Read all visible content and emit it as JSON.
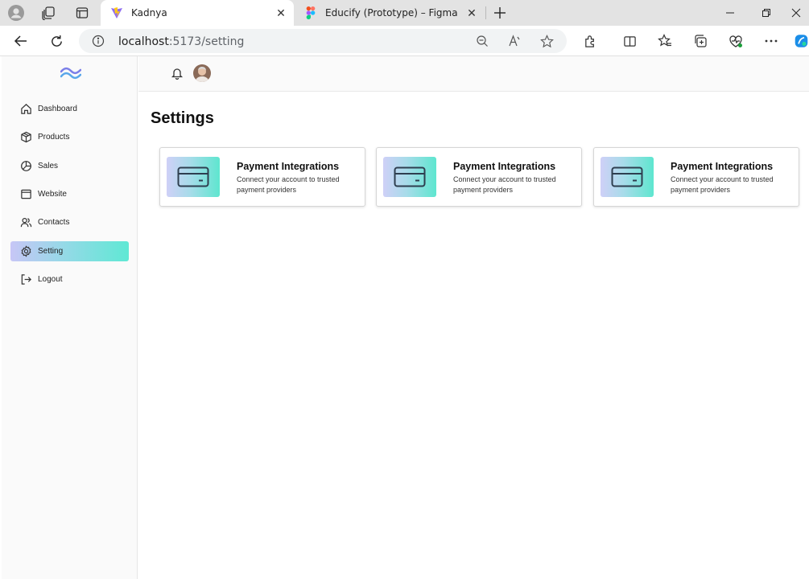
{
  "browser": {
    "tabs": [
      {
        "title": "Kadnya",
        "active": true
      },
      {
        "title": "Educify (Prototype) – Figma",
        "active": false
      }
    ],
    "url": {
      "host": "localhost",
      "path": ":5173/setting"
    }
  },
  "sidebar": {
    "items": [
      {
        "label": "Dashboard",
        "icon": "home-icon",
        "active": false
      },
      {
        "label": "Products",
        "icon": "box-icon",
        "active": false
      },
      {
        "label": "Sales",
        "icon": "pie-chart-icon",
        "active": false
      },
      {
        "label": "Website",
        "icon": "window-icon",
        "active": false
      },
      {
        "label": "Contacts",
        "icon": "users-icon",
        "active": false
      },
      {
        "label": "Setting",
        "icon": "gear-icon",
        "active": true
      },
      {
        "label": "Logout",
        "icon": "logout-icon",
        "active": false
      }
    ]
  },
  "page": {
    "title": "Settings",
    "cards": [
      {
        "title": "Payment Integrations",
        "description": "Connect your account to trusted payment providers",
        "icon": "credit-card-icon"
      },
      {
        "title": "Payment Integrations",
        "description": "Connect your account to trusted payment providers",
        "icon": "credit-card-icon"
      },
      {
        "title": "Payment Integrations",
        "description": "Connect your account to trusted payment providers",
        "icon": "credit-card-icon"
      }
    ]
  },
  "colors": {
    "accent_start": "#c7c6f6",
    "accent_end": "#5fe8d4",
    "logo": "#7b7fe8"
  }
}
